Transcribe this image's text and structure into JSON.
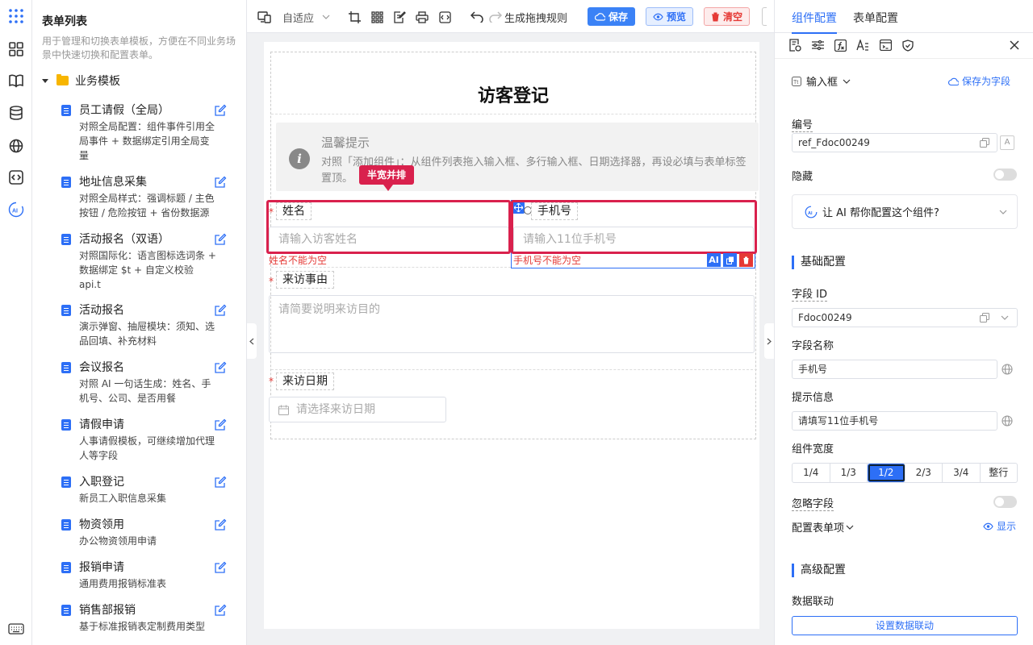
{
  "rail": {
    "icons": [
      "grid-dots-icon",
      "apps-icon",
      "book-icon",
      "database-icon",
      "globe-icon",
      "code-icon",
      "ai-icon",
      "keyboard-icon"
    ]
  },
  "left": {
    "title": "表单列表",
    "desc": "用于管理和切换表单模板，方便在不同业务场景中快速切换和配置表单。",
    "folder": "业务模板",
    "templates": [
      {
        "name": "员工请假（全局）",
        "desc": "对照全局配置：组件事件引用全局事件 + 数据绑定引用全局变量"
      },
      {
        "name": "地址信息采集",
        "desc": "对照全局样式：强调标题 / 主色按钮 / 危险按钮 + 省份数据源"
      },
      {
        "name": "活动报名（双语）",
        "desc": "对照国际化：语言图标选词条 + 数据绑定 $t + 自定义校验 api.t"
      },
      {
        "name": "活动报名",
        "desc": "演示弹窗、抽屉模块：须知、选品回填、补充材料"
      },
      {
        "name": "会议报名",
        "desc": "对照 AI 一句话生成：姓名、手机号、公司、是否用餐"
      },
      {
        "name": "请假申请",
        "desc": "人事请假模板，可继续增加代理人等字段"
      },
      {
        "name": "入职登记",
        "desc": "新员工入职信息采集"
      },
      {
        "name": "物资领用",
        "desc": "办公物资领用申请"
      },
      {
        "name": "报销申请",
        "desc": "通用费用报销标准表"
      },
      {
        "name": "销售部报销",
        "desc": "基于标准报销表定制费用类型"
      }
    ]
  },
  "toolbar": {
    "zoom": "自适应",
    "rules": "生成拖拽规则",
    "save": "保存",
    "preview": "预览",
    "clear": "清空"
  },
  "form": {
    "title": "访客登记",
    "tip_title": "温馨提示",
    "tip_text": "对照「添加组件」：从组件列表拖入输入框、多行输入框、日期选择器，再设必填与表单标签置顶。",
    "badge": "半宽并排",
    "name_label": "姓名",
    "name_ph": "请输入访客姓名",
    "name_err": "姓名不能为空",
    "phone_label": "手机号",
    "phone_ph": "请输入11位手机号",
    "phone_err": "手机号不能为空",
    "reason_label": "来访事由",
    "reason_ph": "请简要说明来访目的",
    "date_label": "来访日期",
    "date_ph": "请选择来访日期",
    "req": "*",
    "ai": "AI"
  },
  "right": {
    "tab1": "组件配置",
    "tab2": "表单配置",
    "comp": "输入框",
    "save_field": "保存为字段",
    "code_label": "编号",
    "code_val": "ref_Fdoc00249",
    "hidden_label": "隐藏",
    "ai_ask": "让 AI 帮你配置这个组件?",
    "basic": "基础配置",
    "fid_label": "字段 ID",
    "fid_val": "Fdoc00249",
    "fname_label": "字段名称",
    "fname_val": "手机号",
    "hint_label": "提示信息",
    "hint_val": "请填写11位手机号",
    "width_label": "组件宽度",
    "widths": [
      "1/4",
      "1/3",
      "1/2",
      "2/3",
      "3/4",
      "整行"
    ],
    "width_selected": "1/2",
    "ignore_label": "忽略字段",
    "cfg_items": "配置表单项",
    "show": "显示",
    "adv": "高级配置",
    "link_label": "数据联动",
    "link_btn": "设置数据联动"
  },
  "colors": {
    "primary": "#2d6ff6",
    "danger": "#d9214d",
    "error": "#e53935"
  }
}
